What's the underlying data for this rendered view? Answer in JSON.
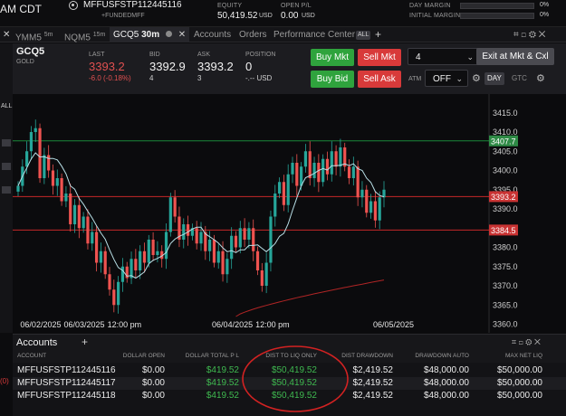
{
  "topbar": {
    "partial_title": "AM CDT",
    "account_id": "MFFUSFSTP112445116",
    "account_sub": "+FUNDEDMFF",
    "equity_label": "EQUITY",
    "equity_value": "50,419.52",
    "equity_ccy": "USD",
    "openpl_label": "OPEN P/L",
    "openpl_value": "0.00",
    "openpl_ccy": "USD",
    "day_margin_label": "DAY MARGIN",
    "day_margin_pct": "0%",
    "initial_margin_label": "INITIAL MARGIN",
    "initial_margin_pct": "0%"
  },
  "tabs": [
    {
      "label": "YMM5",
      "tf": "5m"
    },
    {
      "label": "NQM5",
      "tf": "15m"
    },
    {
      "label": "GCQ5",
      "tf": "30m"
    },
    {
      "label": "Accounts"
    },
    {
      "label": "Orders"
    },
    {
      "label": "Performance Center"
    }
  ],
  "tabs_badge": "ALL",
  "quote": {
    "symbol": "GCQ5",
    "name": "GOLD",
    "last_label": "LAST",
    "last": "3393.2",
    "change": "-6.0 (-0.18%)",
    "bid_label": "BID",
    "bid": "3392.9",
    "bid_size": "4",
    "ask_label": "ASK",
    "ask": "3393.2",
    "ask_size": "3",
    "position_label": "POSITION",
    "position": "0",
    "position_sub": "-.-- USD",
    "buy_mkt": "Buy Mkt",
    "sell_mkt": "Sell Mkt",
    "buy_bid": "Buy Bid",
    "sell_ask": "Sell Ask",
    "qty": "4",
    "exit_label": "Exit at Mkt & Cxl",
    "atm_label": "ATM",
    "atm_value": "OFF",
    "tif_day": "DAY",
    "tif_gtc": "GTC"
  },
  "colors": {
    "up": "#26a69a",
    "down": "#ef5350",
    "green_line": "#1b8a3b",
    "red_line": "#c62828",
    "ma": "#b8dfe6",
    "curve": "#b02525"
  },
  "chart_data": {
    "type": "candlestick",
    "ylim": [
      3362,
      3418
    ],
    "yticks": [
      "3415.0",
      "3410.0",
      "3405.0",
      "3400.0",
      "3395.0",
      "3390.0",
      "3385.0",
      "3380.0",
      "3375.0",
      "3370.0",
      "3365.0",
      "3360.0"
    ],
    "yvalues": [
      3415,
      3410,
      3405,
      3400,
      3395,
      3390,
      3385,
      3380,
      3375,
      3370,
      3365,
      3360
    ],
    "xlabels": [
      {
        "label": "06/02/2025",
        "i": 3
      },
      {
        "label": "06/03/2025",
        "i": 13
      },
      {
        "label": "12:00 pm",
        "i": 23
      },
      {
        "label": "06/04/2025",
        "i": 47
      },
      {
        "label": "12:00 pm",
        "i": 57
      },
      {
        "label": "06/05/2025",
        "i": 84
      }
    ],
    "hlines": [
      {
        "price": 3407.7,
        "label": "3407.7",
        "color": "green"
      },
      {
        "price": 3393.2,
        "label": "3393.2",
        "color": "red"
      },
      {
        "price": 3384.5,
        "label": "3384.5",
        "color": "red"
      }
    ],
    "close": [
      3396,
      3401,
      3405,
      3410,
      3411,
      3398,
      3404,
      3400,
      3396,
      3398,
      3392,
      3394,
      3386,
      3391,
      3385,
      3388,
      3381,
      3384,
      3376,
      3379,
      3373,
      3369,
      3365,
      3371,
      3375,
      3372,
      3377,
      3374,
      3379,
      3376,
      3382,
      3378,
      3379,
      3377,
      3384,
      3393,
      3388,
      3382,
      3386,
      3383,
      3385,
      3381,
      3384,
      3379,
      3382,
      3376,
      3379,
      3373,
      3377,
      3383,
      3380,
      3385,
      3382,
      3385,
      3379,
      3374,
      3370,
      3376,
      3388,
      3394,
      3397,
      3391,
      3399,
      3402,
      3396,
      3401,
      3405,
      3398,
      3402,
      3397,
      3403,
      3399,
      3405,
      3401,
      3406,
      3401,
      3398,
      3401,
      3393,
      3395,
      3389,
      3392,
      3387,
      3393,
      3395
    ]
  },
  "accounts": {
    "title": "Accounts",
    "headers": [
      "ACCOUNT",
      "DOLLAR OPEN",
      "DOLLAR TOTAL P L",
      "DIST TO LIQ ONLY",
      "DIST DRAWDOWN",
      "DRAWDOWN AUTO",
      "MAX NET LIQ"
    ],
    "rows": [
      [
        "MFFUSFSTP112445116",
        "$0.00",
        "$419.52",
        "$50,419.52",
        "$2,419.52",
        "$48,000.00",
        "$50,000.00"
      ],
      [
        "MFFUSFSTP112445117",
        "$0.00",
        "$419.52",
        "$50,419.52",
        "$2,419.52",
        "$48,000.00",
        "$50,000.00"
      ],
      [
        "MFFUSFSTP112445118",
        "$0.00",
        "$419.52",
        "$50,419.52",
        "$2,419.52",
        "$48,000.00",
        "$50,000.00"
      ]
    ],
    "left_edge_mark": "(0)"
  }
}
